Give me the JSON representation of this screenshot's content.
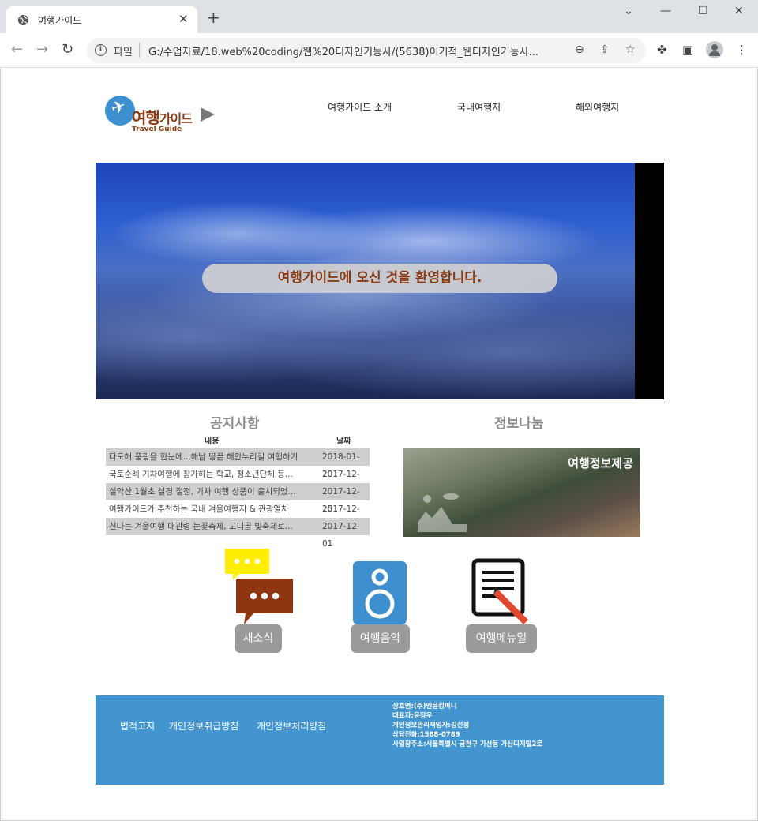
{
  "browser": {
    "tab_title": "여행가이드",
    "scheme_label": "파일",
    "url": "G:/수업자료/18.web%20coding/웹%20디자인기능사/(5638)이기적_웹디자인기능사..."
  },
  "site": {
    "logo_text": "여행",
    "logo_text_small": "가이드",
    "logo_sub": "Travel Guide",
    "nav": [
      "여행가이드 소개",
      "국내여행지",
      "해외여행지"
    ]
  },
  "hero": {
    "banner_text": "여행가이드에 오신 것을 환영합니다."
  },
  "notice": {
    "title": "공지사항",
    "col_content": "내용",
    "col_date": "날짜",
    "rows": [
      {
        "title": "다도해 풍광을 한눈에...해남 땅끝 해안누리길 여행하기",
        "date": "2018-01-10"
      },
      {
        "title": "국토순례 기차여행에 참가하는 학교, 청소년단체 등...",
        "date": "2017-12-21"
      },
      {
        "title": "설악산 1월초 설경 절정, 기차 여행 상품이 출시되었...",
        "date": "2017-12-15"
      },
      {
        "title": "여행가이드가 추천하는 국내 겨울여행지 & 관광열차",
        "date": "2017-12-07"
      },
      {
        "title": "신나는 겨울여행 대관령 눈꽃축제, 고니골 빛축제로...",
        "date": "2017-12-01"
      }
    ]
  },
  "gallery": {
    "title": "정보나눔",
    "image_label": "여행정보제공"
  },
  "quick": {
    "news": "새소식",
    "music": "여행음악",
    "manual": "여행메뉴얼"
  },
  "footer": {
    "links": [
      "법적고지",
      "개인정보취급방침",
      "개인정보처리방침"
    ],
    "company": "상호명:(주)엔윤컴퍼니",
    "ceo": "대표자:윤정우",
    "privacy_officer": "개인정보관리책임자:김선정",
    "phone": "상담전화:1588-0789",
    "address": "사업장주소:서울특별시 금천구 가산동 가산디지털2로"
  },
  "colors": {
    "brand_brown": "#8b3a10",
    "footer_blue": "#4295cf",
    "logo_blue": "#3d8fd0",
    "button_gray": "#9a9a9a"
  }
}
